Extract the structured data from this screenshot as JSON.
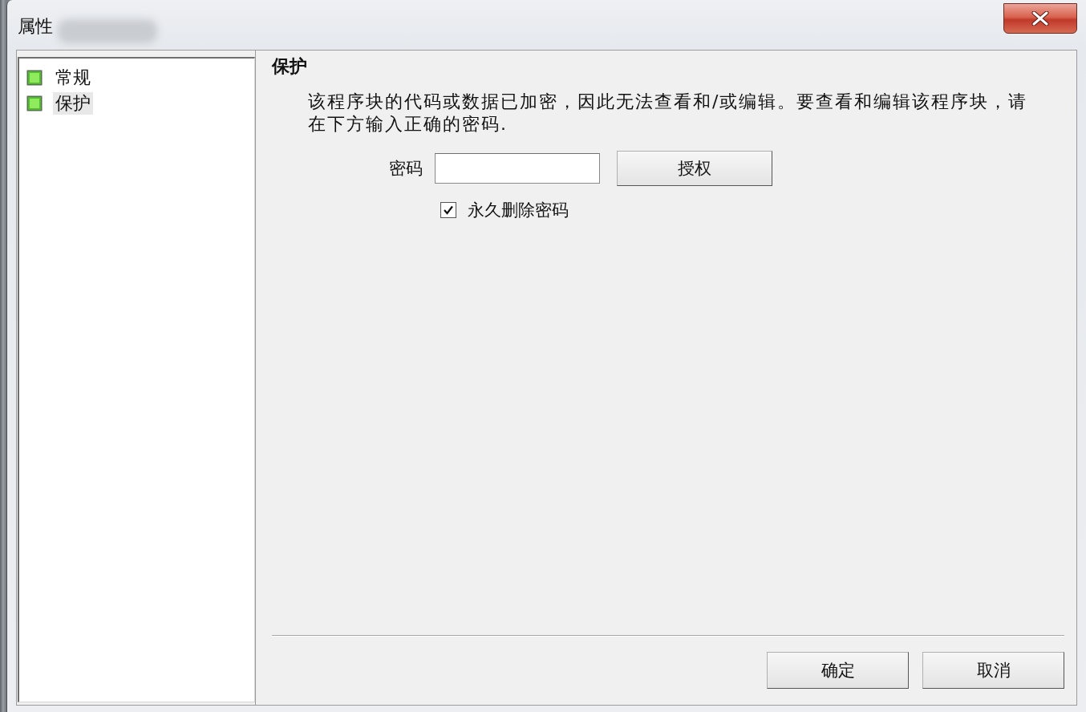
{
  "window": {
    "title": "属性"
  },
  "tree": {
    "items": [
      {
        "label": "常规",
        "selected": false
      },
      {
        "label": "保护",
        "selected": true
      }
    ]
  },
  "panel": {
    "heading": "保护",
    "description": "该程序块的代码或数据已加密，因此无法查看和/或编辑。要查看和编辑该程序块，请在下方输入正确的密码.",
    "password": {
      "label": "密码"
    },
    "authorize_button": "授权",
    "delete_checkbox": {
      "label": "永久删除密码",
      "checked": true
    }
  },
  "buttons": [
    {
      "label": "确定"
    },
    {
      "label": "取消"
    }
  ]
}
